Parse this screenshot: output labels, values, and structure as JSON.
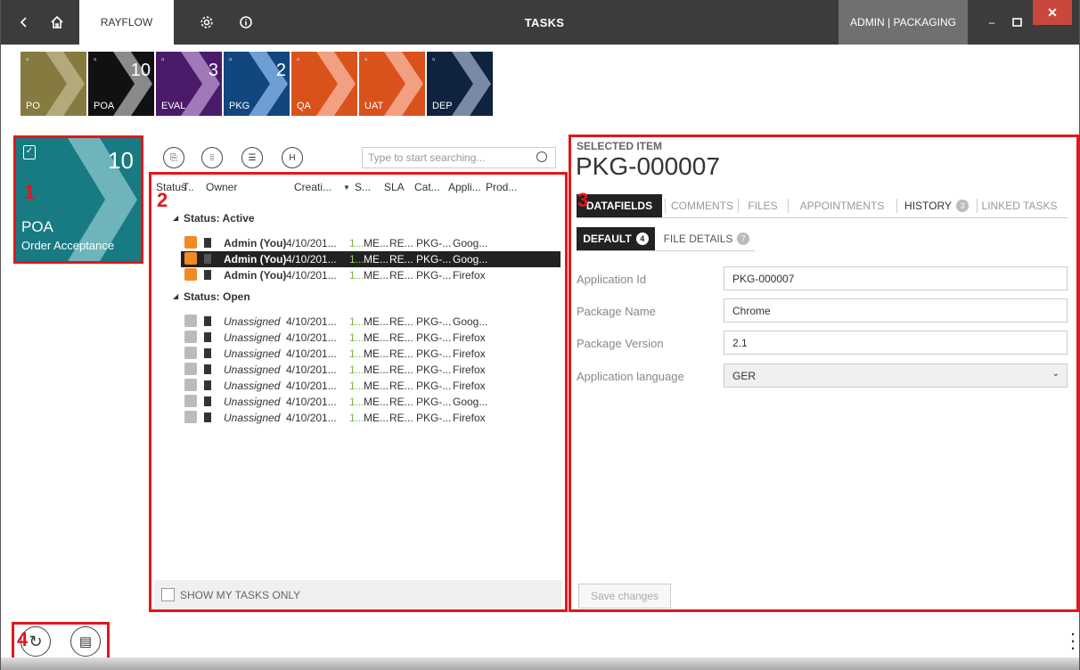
{
  "titlebar": {
    "app_tab": "RAYFLOW",
    "title": "TASKS",
    "user": "ADMIN | PACKAGING",
    "minimize": "–",
    "close": "✕",
    "icons": [
      "back-icon",
      "home-icon",
      "gear-icon",
      "info-icon"
    ]
  },
  "stages": [
    {
      "label": "PO",
      "count": "",
      "color": "#857a40",
      "chevron": "#b3a97a"
    },
    {
      "label": "POA",
      "count": "10",
      "color": "#111111",
      "chevron": "#8a8a8a"
    },
    {
      "label": "EVAL",
      "count": "3",
      "color": "#4b1a68",
      "chevron": "#a079b8"
    },
    {
      "label": "PKG",
      "count": "2",
      "color": "#12467e",
      "chevron": "#6f9ed2"
    },
    {
      "label": "QA",
      "count": "",
      "color": "#d9521c",
      "chevron": "#f2a082"
    },
    {
      "label": "UAT",
      "count": "",
      "color": "#d9521c",
      "chevron": "#f2a082"
    },
    {
      "label": "DEP",
      "count": "",
      "color": "#0f2340",
      "chevron": "#7a8aa6"
    }
  ],
  "current_stage": {
    "short": "POA",
    "name": "Order Acceptance",
    "count": "10",
    "color": "#187a82"
  },
  "callouts": {
    "one": "1",
    "two": "2",
    "three": "3",
    "four": "4"
  },
  "task_list": {
    "search_placeholder": "Type to start searching...",
    "columns": [
      "Status",
      "T..",
      "Owner",
      "Creati...",
      "S...",
      "SLA",
      "Cat...",
      "Appli...",
      "Prod..."
    ],
    "groups": [
      {
        "title": "Status: Active",
        "rows": [
          {
            "owner": "Admin (You)",
            "created": "4/10/201...",
            "s": "1...",
            "sla": "ME...",
            "cat": "RE...",
            "app": "PKG-...",
            "prod": "Goog..."
          },
          {
            "owner": "Admin (You)",
            "created": "4/10/201...",
            "s": "1...",
            "sla": "ME...",
            "cat": "RE...",
            "app": "PKG-...",
            "prod": "Goog..."
          },
          {
            "owner": "Admin (You)",
            "created": "4/10/201...",
            "s": "1...",
            "sla": "ME...",
            "cat": "RE...",
            "app": "PKG-...",
            "prod": "Firefox"
          }
        ]
      },
      {
        "title": "Status: Open",
        "rows": [
          {
            "owner": "Unassigned",
            "created": "4/10/201...",
            "s": "1...",
            "sla": "ME...",
            "cat": "RE...",
            "app": "PKG-...",
            "prod": "Goog..."
          },
          {
            "owner": "Unassigned",
            "created": "4/10/201...",
            "s": "1...",
            "sla": "ME...",
            "cat": "RE...",
            "app": "PKG-...",
            "prod": "Firefox"
          },
          {
            "owner": "Unassigned",
            "created": "4/10/201...",
            "s": "1...",
            "sla": "ME...",
            "cat": "RE...",
            "app": "PKG-...",
            "prod": "Firefox"
          },
          {
            "owner": "Unassigned",
            "created": "4/10/201...",
            "s": "1...",
            "sla": "ME...",
            "cat": "RE...",
            "app": "PKG-...",
            "prod": "Firefox"
          },
          {
            "owner": "Unassigned",
            "created": "4/10/201...",
            "s": "1...",
            "sla": "ME...",
            "cat": "RE...",
            "app": "PKG-...",
            "prod": "Firefox"
          },
          {
            "owner": "Unassigned",
            "created": "4/10/201...",
            "s": "1...",
            "sla": "ME...",
            "cat": "RE...",
            "app": "PKG-...",
            "prod": "Goog..."
          },
          {
            "owner": "Unassigned",
            "created": "4/10/201...",
            "s": "1...",
            "sla": "ME...",
            "cat": "RE...",
            "app": "PKG-...",
            "prod": "Firefox"
          }
        ]
      }
    ],
    "show_my_tasks_only": "SHOW MY TASKS ONLY"
  },
  "detail": {
    "header": "SELECTED ITEM",
    "item_id": "PKG-000007",
    "tabs": [
      {
        "label": "DATAFIELDS",
        "active": true,
        "badge": ""
      },
      {
        "label": "COMMENTS",
        "active": false,
        "badge": ""
      },
      {
        "label": "FILES",
        "active": false,
        "badge": ""
      },
      {
        "label": "APPOINTMENTS",
        "active": false,
        "badge": ""
      },
      {
        "label": "HISTORY",
        "active": false,
        "badge": "3"
      },
      {
        "label": "LINKED TASKS",
        "active": false,
        "badge": ""
      }
    ],
    "subtabs": [
      {
        "label": "DEFAULT",
        "badge": "4",
        "active": true
      },
      {
        "label": "FILE DETAILS",
        "badge": "7",
        "active": false
      }
    ],
    "fields": [
      {
        "label": "Application Id",
        "value": "PKG-000007"
      },
      {
        "label": "Package Name",
        "value": "Chrome"
      },
      {
        "label": "Package Version",
        "value": "2.1"
      },
      {
        "label": "Application language",
        "value": "GER"
      }
    ],
    "save_label": "Save changes"
  },
  "colors": {
    "accent_red": "#e3161b",
    "selected_row": "#222222",
    "active_status": "#f08a24"
  }
}
